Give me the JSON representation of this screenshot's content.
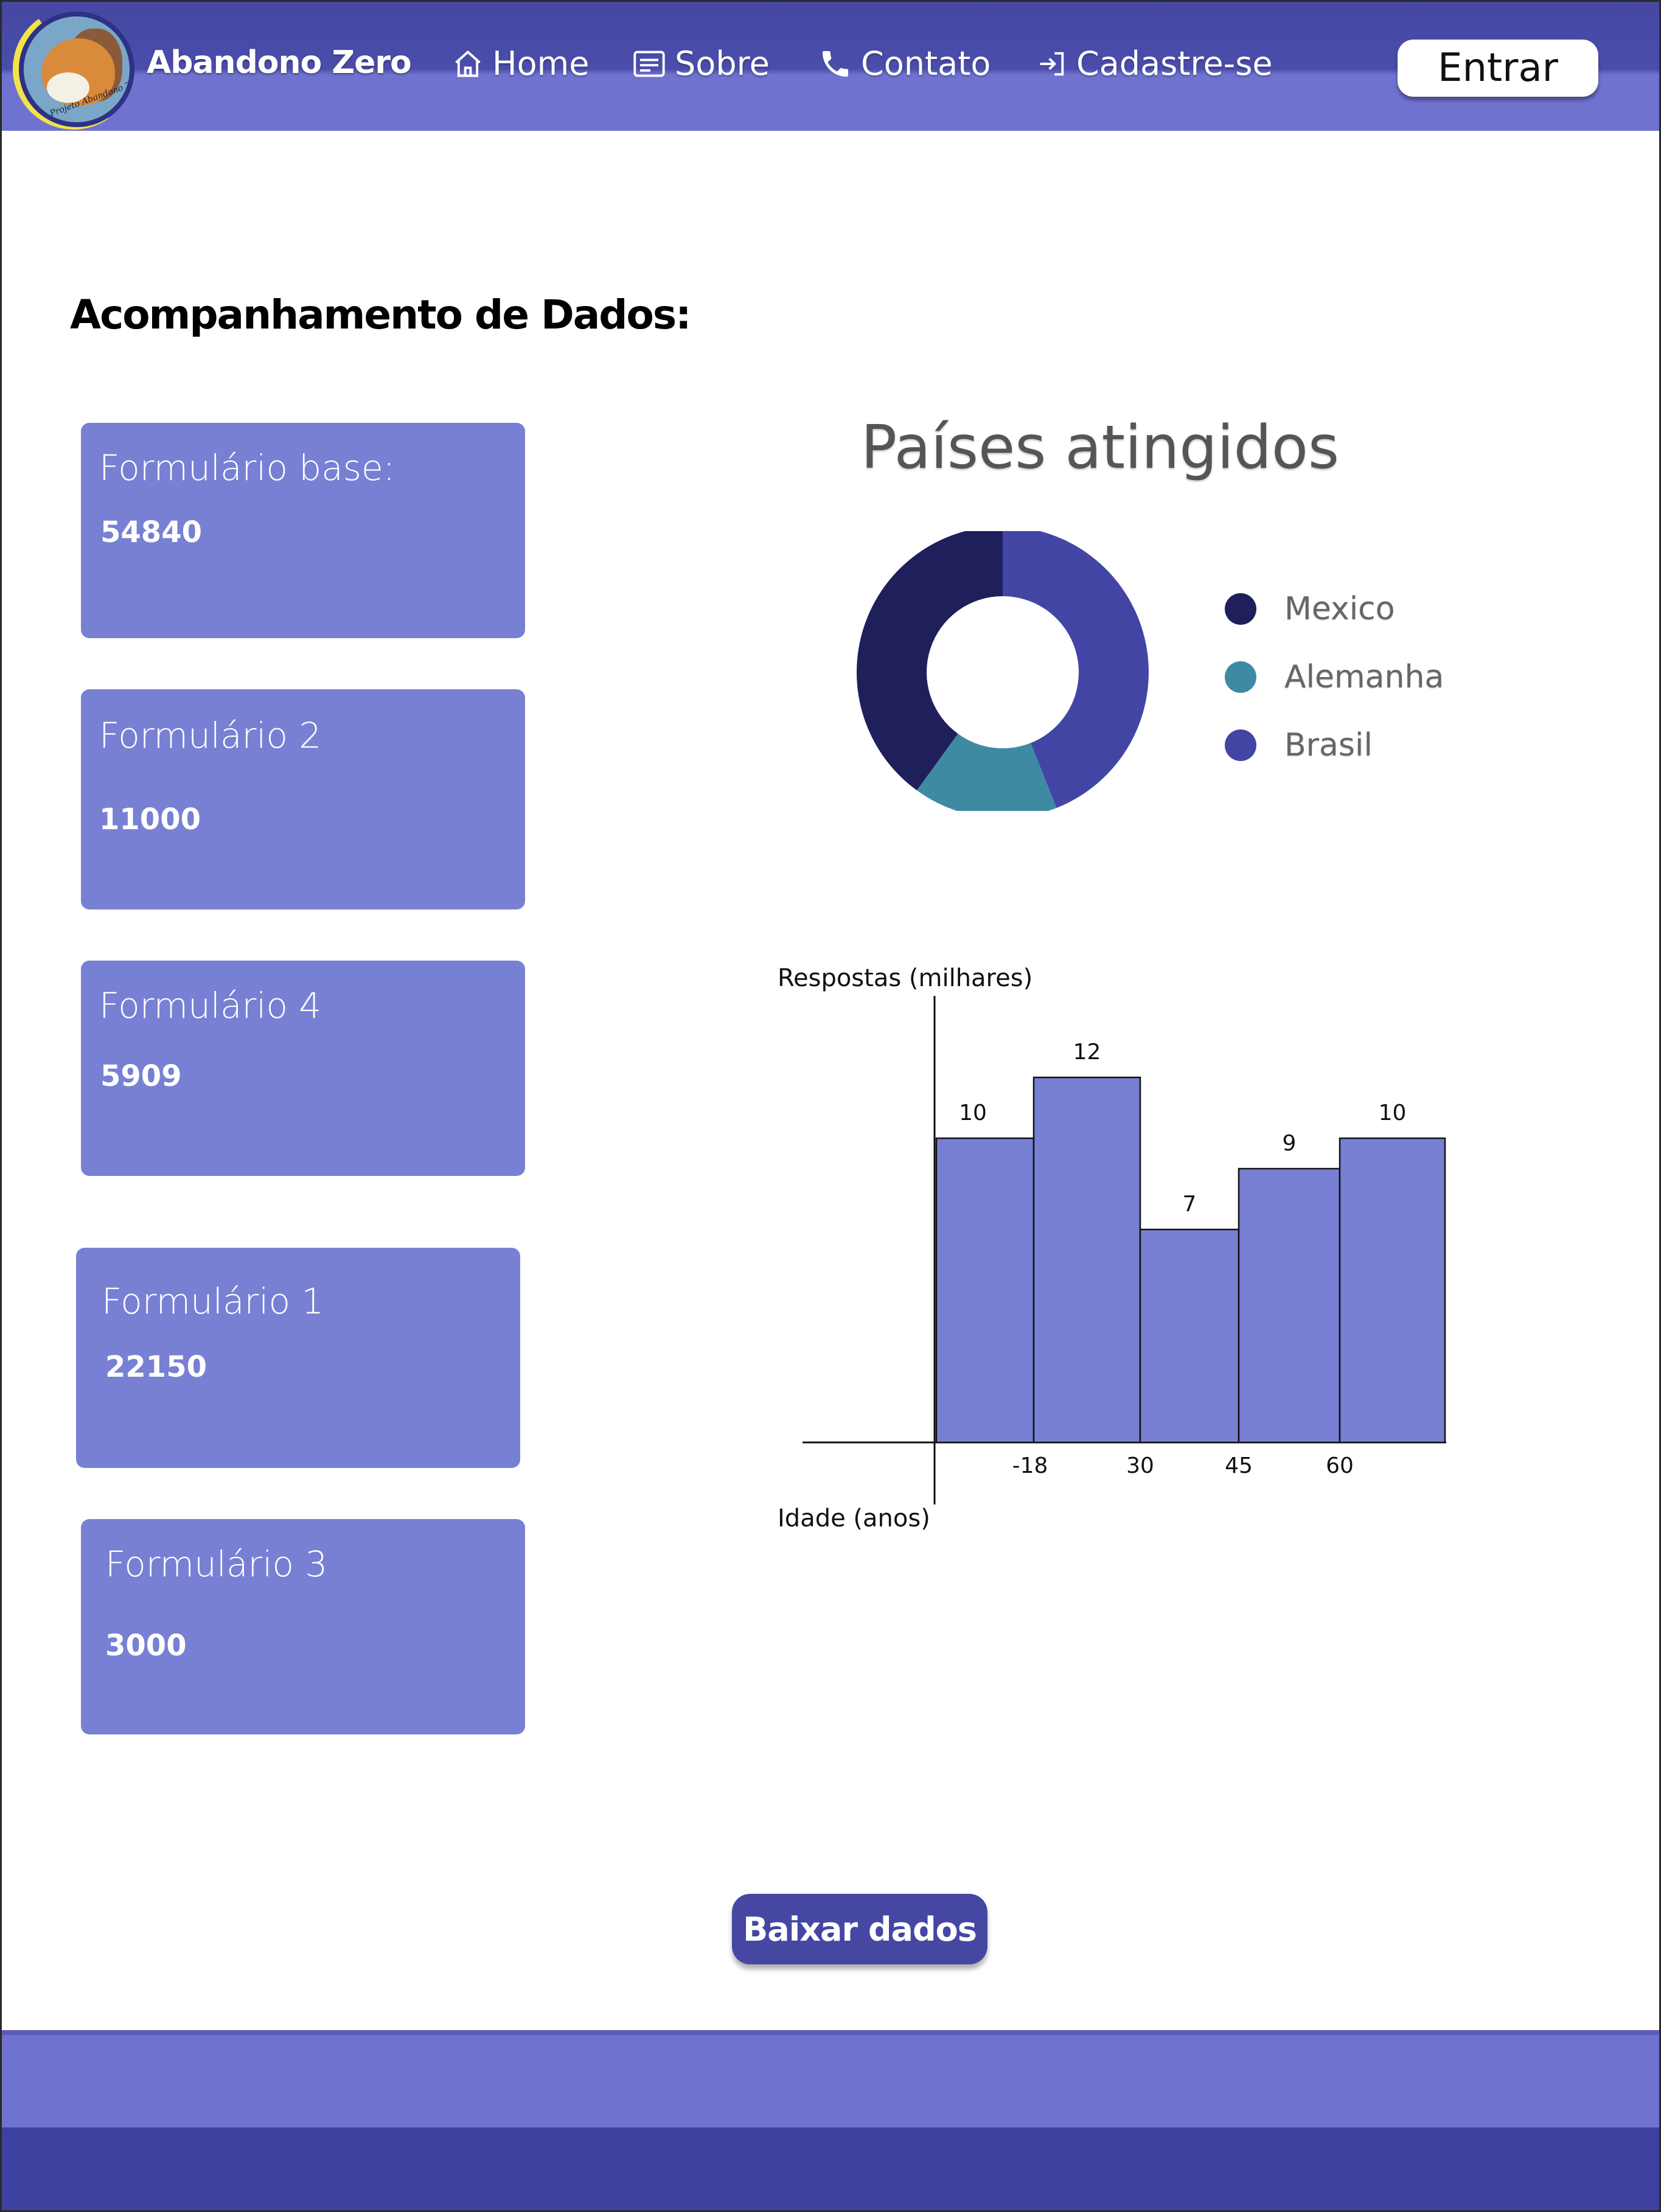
{
  "header": {
    "brand": "Abandono Zero",
    "logo_text": "Projeto Abandono Zero",
    "nav": {
      "home": "Home",
      "sobre": "Sobre",
      "contato": "Contato",
      "cadastre": "Cadastre-se"
    },
    "login_label": "Entrar",
    "colors": {
      "header_top": "#4547a3",
      "header_bottom": "#7072d0"
    }
  },
  "main": {
    "title": "Acompanhamento de Dados:",
    "cards": [
      {
        "label": "Formulário base:",
        "value": "54840"
      },
      {
        "label": "Formulário 2",
        "value": "11000"
      },
      {
        "label": "Formulário 4",
        "value": "5909"
      },
      {
        "label": "Formulário 1",
        "value": "22150"
      },
      {
        "label": "Formulário 3",
        "value": "3000"
      }
    ],
    "card_color": "#7880d4",
    "download_label": "Baixar dados"
  },
  "chart_data": [
    {
      "type": "pie",
      "title": "Países atingidos",
      "donut": true,
      "categories": [
        "Mexico",
        "Alemanha",
        "Brasil"
      ],
      "values": [
        40,
        16,
        44
      ],
      "colors": [
        "#1f1f5c",
        "#3f8aa3",
        "#4345a5"
      ],
      "legend": "right"
    },
    {
      "type": "bar",
      "title": "",
      "ylabel": "Respostas (milhares)",
      "xlabel": "Idade (anos)",
      "x_ticks": [
        "-18",
        "30",
        "45",
        "60"
      ],
      "values": [
        10,
        12,
        7,
        9,
        10
      ],
      "data_labels": [
        "10",
        "12",
        "7",
        "9",
        "10"
      ],
      "ylim": [
        0,
        13
      ],
      "color": "#7880d4"
    }
  ]
}
